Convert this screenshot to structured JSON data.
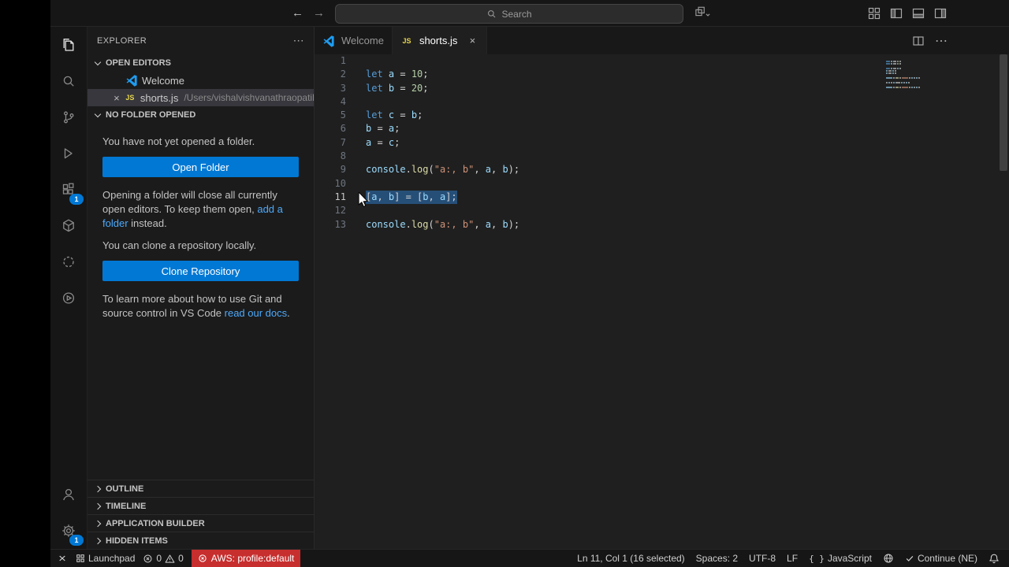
{
  "title_bar": {
    "search_placeholder": "Search"
  },
  "activity_bar": {
    "extensions_badge": "1",
    "settings_badge": "1"
  },
  "sidebar": {
    "title": "EXPLORER",
    "open_editors": {
      "label": "OPEN EDITORS",
      "welcome_label": "Welcome",
      "file_label": "shorts.js",
      "file_description": "/Users/vishalvishvanathraopatil"
    },
    "no_folder": {
      "label": "NO FOLDER OPENED",
      "intro": "You have not yet opened a folder.",
      "open_folder_button": "Open Folder",
      "keep_open_text_1": "Opening a folder will close all currently open editors. To keep them open, ",
      "keep_open_link": "add a folder",
      "keep_open_text_2": " instead.",
      "clone_text": "You can clone a repository locally.",
      "clone_button": "Clone Repository",
      "docs_text_1": "To learn more about how to use Git and source control in VS Code ",
      "docs_link": "read our docs",
      "docs_text_2": "."
    },
    "sections": {
      "outline": "OUTLINE",
      "timeline": "TIMELINE",
      "app_builder": "APPLICATION BUILDER",
      "hidden_items": "HIDDEN ITEMS"
    }
  },
  "tabs": {
    "welcome": "Welcome",
    "file": "shorts.js"
  },
  "icons": {
    "js_label": "JS"
  },
  "editor": {
    "active_line": 11,
    "selected_line": 11,
    "selected_text": "[a, b] = [b, a];",
    "lines": [
      [],
      [
        [
          "let ",
          "kw"
        ],
        [
          "a",
          "var"
        ],
        [
          " = ",
          "op"
        ],
        [
          "10",
          "num"
        ],
        [
          ";",
          "op"
        ]
      ],
      [
        [
          "let ",
          "kw"
        ],
        [
          "b",
          "var"
        ],
        [
          " = ",
          "op"
        ],
        [
          "20",
          "num"
        ],
        [
          ";",
          "op"
        ]
      ],
      [],
      [
        [
          "let ",
          "kw"
        ],
        [
          "c",
          "var"
        ],
        [
          " = ",
          "op"
        ],
        [
          "b",
          "var"
        ],
        [
          ";",
          "op"
        ]
      ],
      [
        [
          "b",
          "var"
        ],
        [
          " = ",
          "op"
        ],
        [
          "a",
          "var"
        ],
        [
          ";",
          "op"
        ]
      ],
      [
        [
          "a",
          "var"
        ],
        [
          " = ",
          "op"
        ],
        [
          "c",
          "var"
        ],
        [
          ";",
          "op"
        ]
      ],
      [],
      [
        [
          "console",
          "var"
        ],
        [
          ".",
          "op"
        ],
        [
          "log",
          "fn"
        ],
        [
          "(",
          "op"
        ],
        [
          "\"a:, b\"",
          "str"
        ],
        [
          ", ",
          "op"
        ],
        [
          "a",
          "var"
        ],
        [
          ", ",
          "op"
        ],
        [
          "b",
          "var"
        ],
        [
          ");",
          "op"
        ]
      ],
      [],
      [
        [
          "[",
          "op"
        ],
        [
          "a",
          "var"
        ],
        [
          ", ",
          "op"
        ],
        [
          "b",
          "var"
        ],
        [
          "] = [",
          "op"
        ],
        [
          "b",
          "var"
        ],
        [
          ", ",
          "op"
        ],
        [
          "a",
          "var"
        ],
        [
          "];",
          "op"
        ]
      ],
      [],
      [
        [
          "console",
          "var"
        ],
        [
          ".",
          "op"
        ],
        [
          "log",
          "fn"
        ],
        [
          "(",
          "op"
        ],
        [
          "\"a:, b\"",
          "str"
        ],
        [
          ", ",
          "op"
        ],
        [
          "a",
          "var"
        ],
        [
          ", ",
          "op"
        ],
        [
          "b",
          "var"
        ],
        [
          ");",
          "op"
        ]
      ]
    ]
  },
  "status_bar": {
    "launchpad": "Launchpad",
    "errors": "0",
    "warnings": "0",
    "aws_profile": "AWS: profile:default",
    "line_col": "Ln 11, Col 1 (16 selected)",
    "indent": "Spaces: 2",
    "encoding": "UTF-8",
    "eol": "LF",
    "language_icon": "{ }",
    "language": "JavaScript",
    "continue_label": "Continue (NE)"
  },
  "colors": {
    "accent": "#0078d4",
    "link": "#4daafc",
    "selection": "#264f78",
    "aws_badge": "#c72e2e",
    "keyword": "#569cd6",
    "variable": "#9cdcfe",
    "number": "#b5cea8",
    "string": "#ce9178",
    "function": "#dcdcaa"
  }
}
